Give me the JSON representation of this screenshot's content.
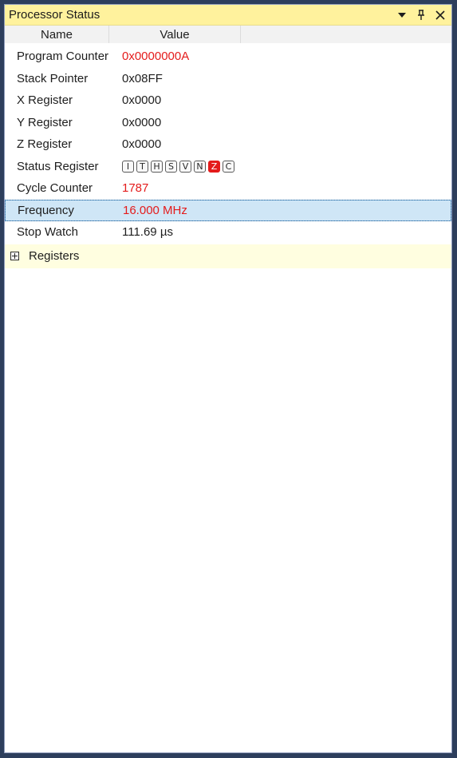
{
  "panel": {
    "title": "Processor Status"
  },
  "columns": {
    "name": "Name",
    "value": "Value"
  },
  "rows": [
    {
      "name": "Program Counter",
      "value": "0x0000000A",
      "changed": true
    },
    {
      "name": "Stack Pointer",
      "value": "0x08FF",
      "changed": false
    },
    {
      "name": "X Register",
      "value": "0x0000",
      "changed": false
    },
    {
      "name": "Y Register",
      "value": "0x0000",
      "changed": false
    },
    {
      "name": "Z Register",
      "value": "0x0000",
      "changed": false
    },
    {
      "name": "Status Register",
      "flags": [
        {
          "letter": "I",
          "set": false
        },
        {
          "letter": "T",
          "set": false
        },
        {
          "letter": "H",
          "set": false
        },
        {
          "letter": "S",
          "set": false
        },
        {
          "letter": "V",
          "set": false
        },
        {
          "letter": "N",
          "set": false
        },
        {
          "letter": "Z",
          "set": true
        },
        {
          "letter": "C",
          "set": false
        }
      ]
    },
    {
      "name": "Cycle Counter",
      "value": "1787",
      "changed": true
    },
    {
      "name": "Frequency",
      "value": "16.000 MHz",
      "changed": true,
      "selected": true
    },
    {
      "name": "Stop Watch",
      "value": "111.69 µs",
      "changed": false
    }
  ],
  "group": {
    "label": "Registers",
    "expanded": false
  },
  "colors": {
    "title_bar": "#fff29d",
    "changed_value": "#e41b1b",
    "selection": "#cfe6f6",
    "group_background": "#fffee0"
  },
  "icons": {
    "dropdown": "chevron-down-icon",
    "pin": "pin-icon",
    "close": "close-icon",
    "expand": "plus-box-icon"
  }
}
